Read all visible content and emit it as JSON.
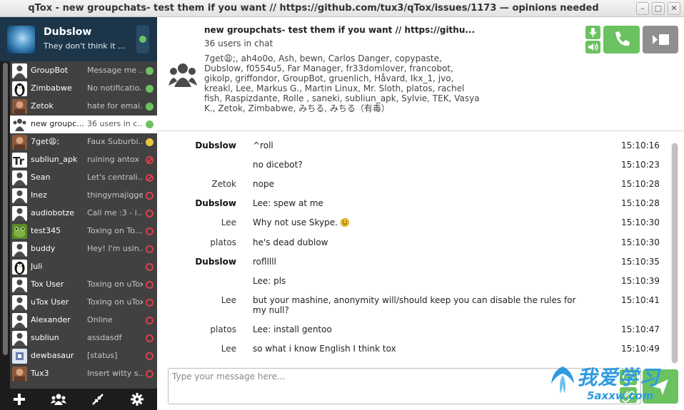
{
  "window": {
    "title": "qTox - new groupchats- test them if you want // https://github.com/tux3/qTox/issues/1173 — opinions needed",
    "controls": [
      "minimize",
      "maximize",
      "close"
    ]
  },
  "self": {
    "name": "Dubslow",
    "status": "They don't think it ...",
    "status_color": "#6bc260"
  },
  "contacts": [
    {
      "name": "GroupBot",
      "status": "Message me ...",
      "presence": "online",
      "avatar": "person-icon"
    },
    {
      "name": "Zimbabwe",
      "status": "No notificatio...",
      "presence": "online",
      "avatar": "tux-avatar"
    },
    {
      "name": "Zetok",
      "status": "hate for emai...",
      "presence": "online",
      "avatar": "photo-avatar"
    },
    {
      "name": "new groupc...",
      "status": "36 users in c...",
      "presence": "online",
      "avatar": "group-icon",
      "active": true
    },
    {
      "name": "7get😩;",
      "status": "Faux Suburbi...",
      "presence": "away",
      "avatar": "photo-avatar"
    },
    {
      "name": "subliun_apk",
      "status": "ruining antox",
      "presence": "busy",
      "avatar": "text-avatar"
    },
    {
      "name": "Sean",
      "status": "Let's centrali...",
      "presence": "busy",
      "avatar": "person-icon"
    },
    {
      "name": "Inez",
      "status": "thingymajigger",
      "presence": "offline",
      "avatar": "person-icon"
    },
    {
      "name": "audiobotze",
      "status": "Call me :3  - i...",
      "presence": "offline",
      "avatar": "person-icon"
    },
    {
      "name": "test345",
      "status": "Toxing on To...",
      "presence": "offline",
      "avatar": "frog-avatar"
    },
    {
      "name": "buddy",
      "status": "Hey! I'm usin...",
      "presence": "offline",
      "avatar": "person-icon"
    },
    {
      "name": "Juli",
      "status": "",
      "presence": "offline",
      "avatar": "tux-avatar"
    },
    {
      "name": "Tox User",
      "status": "Toxing on uTox",
      "presence": "offline",
      "avatar": "person-icon"
    },
    {
      "name": "uTox User",
      "status": "Toxing on uTox",
      "presence": "offline",
      "avatar": "person-icon"
    },
    {
      "name": "Alexander",
      "status": "Online",
      "presence": "offline",
      "avatar": "person-icon"
    },
    {
      "name": "subliun",
      "status": "assdasdf",
      "presence": "offline",
      "avatar": "person-icon"
    },
    {
      "name": "dewbasaur",
      "status": "[status]",
      "presence": "offline",
      "avatar": "pixel-avatar"
    },
    {
      "name": "Tux3",
      "status": "Insert witty s...",
      "presence": "offline",
      "avatar": "photo-avatar"
    }
  ],
  "bottom_bar": [
    "add-icon",
    "group-icon",
    "transfer-icon",
    "gear-icon"
  ],
  "chat": {
    "title": "new groupchats- test them if you want // https://githu...",
    "user_count": "36 users in chat",
    "members": "7get😩;,  ah4o0o,  Ash,  bewn,  Carlos Danger,  copypaste,  Dubslow,  f0554u5,  Far Manager,  fr33domlover,  francobot,  gikolp,  griffondor,  GroupBot,  gruenlich,  Håvard,  Ikx_1,  jvo,  kreakl,  Lee,  Markus G.,  Martin Linux,  Mr. Sloth,  platos,  rachel fish,  Raspizdante,  Rolle ,  saneki,  subliun_apk,  Sylvie,  TEK,  Vasya K.,  Zetok,  Zimbabwe,  みちる,  みちる（有毒）"
  },
  "messages": [
    {
      "author": "Dubslow",
      "bold": true,
      "text": "^roll",
      "time": "15:10:16"
    },
    {
      "author": "",
      "bold": false,
      "text": "no dicebot?",
      "time": "15:10:23"
    },
    {
      "author": "Zetok",
      "bold": false,
      "text": "nope",
      "time": "15:10:28"
    },
    {
      "author": "Dubslow",
      "bold": true,
      "text": "Lee: spew at me",
      "time": "15:10:28"
    },
    {
      "author": "Lee",
      "bold": false,
      "text": "Why not use Skype.",
      "time": "15:10:30",
      "emoji": "smile-icon"
    },
    {
      "author": "platos",
      "bold": false,
      "text": "he's dead dublow",
      "time": "15:10:30"
    },
    {
      "author": "Dubslow",
      "bold": true,
      "text": "roflllll",
      "time": "15:10:35"
    },
    {
      "author": "",
      "bold": false,
      "text": "Lee: pls",
      "time": "15:10:39"
    },
    {
      "author": "Lee",
      "bold": false,
      "text": "but your mashine, anonymity will/should keep you can disable the rules for my null?",
      "time": "15:10:41"
    },
    {
      "author": "platos",
      "bold": false,
      "text": "Lee: install gentoo",
      "time": "15:10:47"
    },
    {
      "author": "Lee",
      "bold": false,
      "text": "so what i know English I think tox",
      "time": "15:10:49"
    }
  ],
  "input": {
    "placeholder": "Type your message here...",
    "value": ""
  },
  "watermark": {
    "main": "我爱学习",
    "sub": "5axxw.com"
  },
  "colors": {
    "accent": "#6bc260",
    "sidebar_bg": "#414141",
    "self_bg": "#1c3549",
    "busy": "#d9414b",
    "away": "#e5c840"
  }
}
